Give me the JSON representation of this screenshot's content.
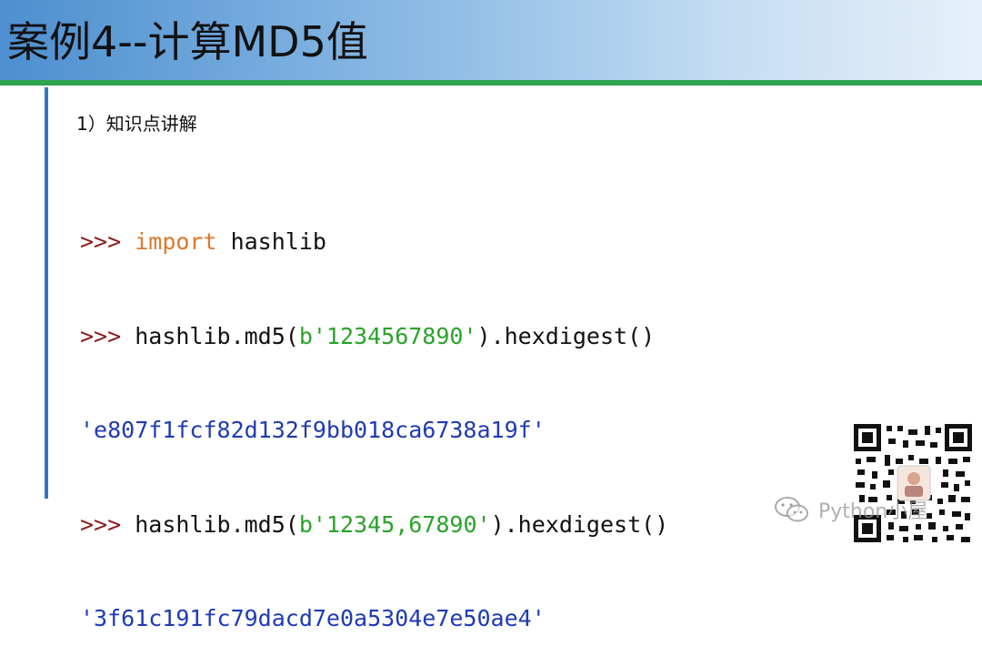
{
  "slide": {
    "title": "案例4--计算MD5值",
    "section_heading": "1）知识点讲解"
  },
  "code": {
    "lines": [
      {
        "prompt": ">>> ",
        "keyword": "import",
        "rest": " hashlib"
      },
      {
        "prompt": ">>> ",
        "pre": "hashlib.md5(",
        "string": "b'1234567890'",
        "post": ").hexdigest()"
      },
      {
        "output": "'e807f1fcf82d132f9bb018ca6738a19f'"
      },
      {
        "prompt": ">>> ",
        "pre": "hashlib.md5(",
        "string": "b'12345,67890'",
        "post": ").hexdigest()"
      },
      {
        "output": "'3f61c191fc79dacd7e0a5304e7e50ae4'"
      }
    ]
  },
  "watermark": {
    "text": "Python小屋",
    "icon": "wechat-icon"
  },
  "colors": {
    "prompt": "#8b1a1a",
    "keyword": "#e0782a",
    "string": "#29a329",
    "output": "#1f3ab4",
    "accent_line": "#2ea44f",
    "vertical_rule": "#2f78c4"
  }
}
